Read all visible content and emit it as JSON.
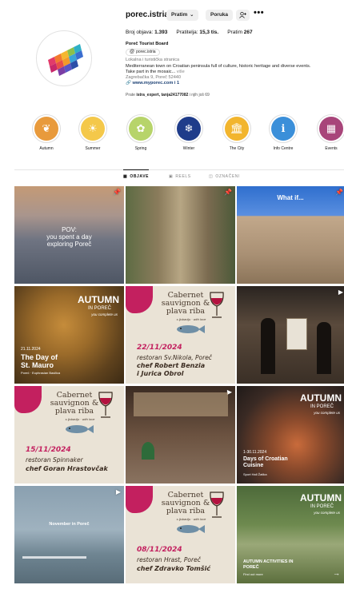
{
  "profile": {
    "username": "porec.istria",
    "follow_button": "Pratim",
    "message_button": "Poruka",
    "stats": {
      "posts_label": "Broj objava:",
      "posts_value": "1.393",
      "followers_label": "Pratitelja:",
      "followers_value": "15,3 tis.",
      "following_label": "Pratim",
      "following_value": "267"
    },
    "display_name": "Poreč Tourist Board",
    "threads_badge": "porec.istria",
    "category": "Lokalna i turistička stranica",
    "bio_line1": "Mediterranean town on Croatian peninsula full of culture, historic heritage and diverse events.",
    "bio_line2": "Take part in the mosaic...",
    "bio_more": "više",
    "address": "Zagrebačka 9, Poreč 52440",
    "link": "www.myporec.com i 1",
    "followed_prefix": "Prate",
    "followed_names": "istra_expert, tanja24177082",
    "followed_suffix": "i njih još 69"
  },
  "highlights": [
    {
      "label": "Autumn",
      "color": "#e89a3c",
      "icon": "leaf-icon",
      "glyph": "❦"
    },
    {
      "label": "Summer",
      "color": "#f4c84a",
      "icon": "sun-icon",
      "glyph": "☀"
    },
    {
      "label": "Spring",
      "color": "#b7d46a",
      "icon": "flower-icon",
      "glyph": "✿"
    },
    {
      "label": "Winter",
      "color": "#1f3c8a",
      "icon": "snowflake-icon",
      "glyph": "❄"
    },
    {
      "label": "The City",
      "color": "#f2b52e",
      "icon": "building-icon",
      "glyph": "🏛"
    },
    {
      "label": "Info Centre",
      "color": "#3b8fd9",
      "icon": "info-icon",
      "glyph": "ℹ"
    },
    {
      "label": "Events",
      "color": "#a8457a",
      "icon": "calendar-icon",
      "glyph": "▦"
    }
  ],
  "tabs": [
    {
      "label": "OBJAVE",
      "icon": "grid-icon"
    },
    {
      "label": "REELS",
      "icon": "reels-icon"
    },
    {
      "label": "OZNAČENI",
      "icon": "tagged-icon"
    }
  ],
  "posts": {
    "p1": {
      "line1": "POV:",
      "line2": "you spent a day",
      "line3": "exploring Poreč"
    },
    "p3": {
      "text": "What if..."
    },
    "p4": {
      "title": "AUTUMN",
      "sub": "IN POREČ",
      "script": "you complete us",
      "date": "21.11.2024",
      "event1": "The Day of",
      "event2": "St. Mauro",
      "foot": "Poreč · Euphrasian Basilica"
    },
    "wine_title": "Cabernet sauvignon & plava riba",
    "wine_sub": "s ljubavlju · with love",
    "p5": {
      "date": "22/11/2024",
      "rest": "restoran Sv.Nikola, Poreč",
      "chef1": "chef Robert Benzia",
      "chef2": "i Jurica Obrol"
    },
    "p7": {
      "date": "15/11/2024",
      "rest": "restoran Spinnaker",
      "chef1": "chef Goran Hrastovčak"
    },
    "p9": {
      "title": "AUTUMN",
      "sub": "IN POREČ",
      "script": "you complete us",
      "date": "1-30.11.2024",
      "event1": "Days of Croatian",
      "event2": "Cuisine",
      "foot": "Sport Hall Žatika"
    },
    "p10": {
      "text": "November in Poreč"
    },
    "p11": {
      "date": "08/11/2024",
      "rest": "restoran Hrast, Poreč",
      "chef1": "chef Zdravko Tomšić"
    },
    "p12": {
      "title": "AUTUMN",
      "sub": "IN POREČ",
      "script": "you complete us",
      "event": "AUTUMN ACTIVITIES IN POREČ",
      "foot": "Find out more"
    }
  }
}
